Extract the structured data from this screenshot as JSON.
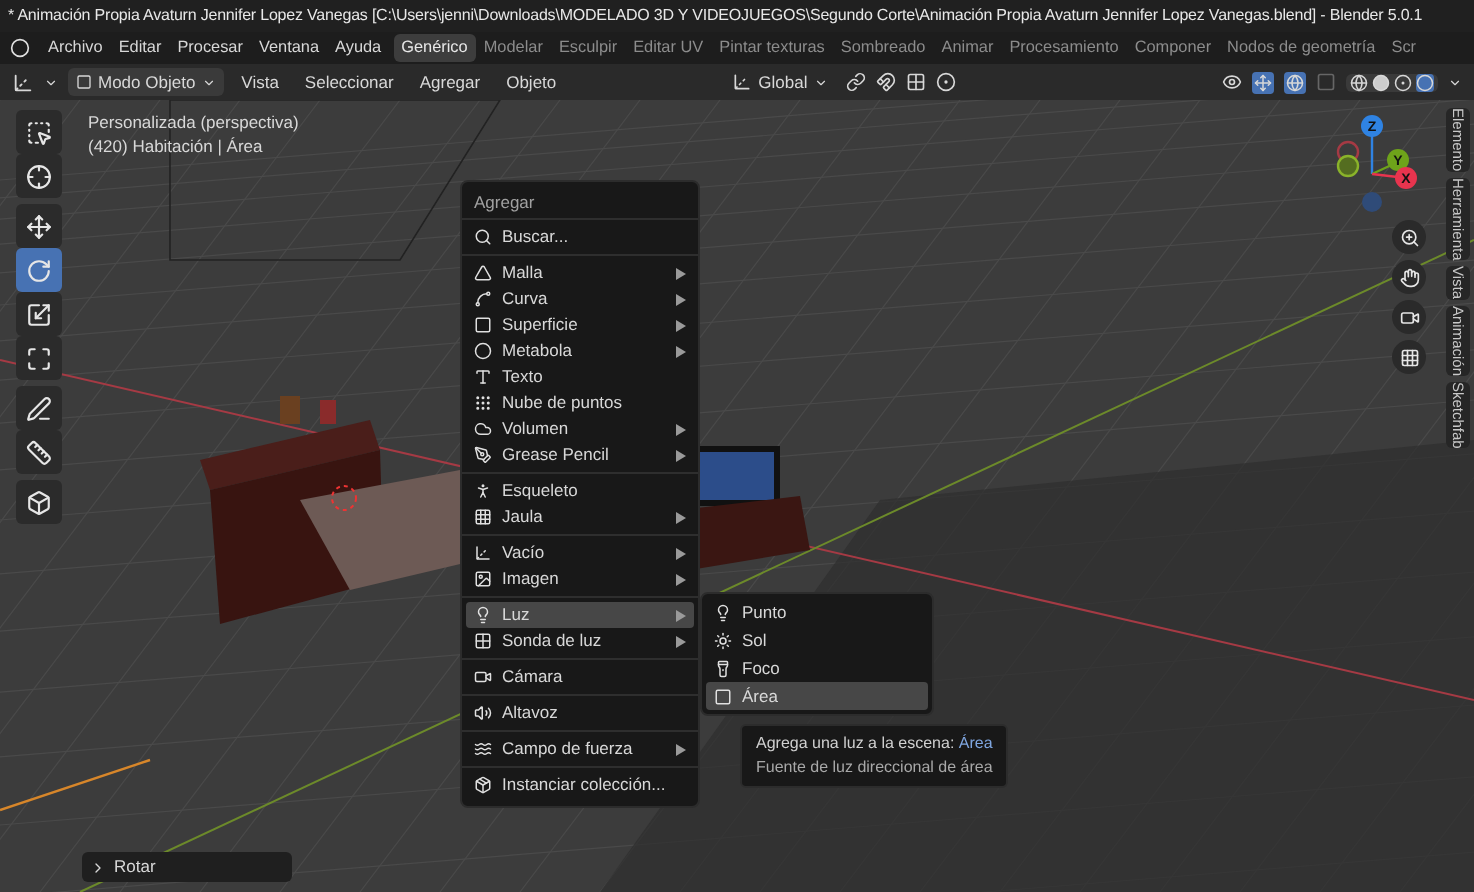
{
  "window": {
    "title": "* Animación Propia Avaturn Jennifer Lopez Vanegas [C:\\Users\\jenni\\Downloads\\MODELADO 3D Y VIDEOJUEGOS\\Segundo Corte\\Animación Propia Avaturn Jennifer Lopez Vanegas.blend] - Blender 5.0.1"
  },
  "menu_bar": {
    "items": [
      "Archivo",
      "Editar",
      "Procesar",
      "Ventana",
      "Ayuda"
    ]
  },
  "workspaces": [
    {
      "label": "Genérico",
      "selected": true
    },
    {
      "label": "Modelar",
      "selected": false
    },
    {
      "label": "Esculpir",
      "selected": false
    },
    {
      "label": "Editar UV",
      "selected": false
    },
    {
      "label": "Pintar texturas",
      "selected": false
    },
    {
      "label": "Sombreado",
      "selected": false
    },
    {
      "label": "Animar",
      "selected": false
    },
    {
      "label": "Procesamiento",
      "selected": false
    },
    {
      "label": "Componer",
      "selected": false
    },
    {
      "label": "Nodos de geometría",
      "selected": false
    },
    {
      "label": "Scr",
      "selected": false
    }
  ],
  "header": {
    "mode": "Modo Objeto",
    "menus": [
      "Vista",
      "Seleccionar",
      "Agregar",
      "Objeto"
    ],
    "orientation": "Global"
  },
  "viewport": {
    "view_name": "Personalizada (perspectiva)",
    "object_info": "(420) Habitación | Área"
  },
  "tools": [
    {
      "selected": false
    },
    {
      "selected": false
    },
    {
      "selected": false
    },
    {
      "selected": true
    },
    {
      "selected": false
    },
    {
      "selected": false
    },
    {
      "selected": false
    },
    {
      "selected": false
    },
    {
      "selected": false
    }
  ],
  "gizmo": {
    "axes": [
      "Z",
      "Y",
      "X"
    ]
  },
  "sidebar_tabs": [
    "Elemento",
    "Herramienta",
    "Vista",
    "Animación",
    "Sketchfab"
  ],
  "add_menu": {
    "title": "Agregar",
    "groups": [
      {
        "items": [
          {
            "label": "Buscar...",
            "submenu": false,
            "selected": false
          }
        ]
      },
      {
        "items": [
          {
            "label": "Malla",
            "submenu": true,
            "selected": false
          },
          {
            "label": "Curva",
            "submenu": true,
            "selected": false
          },
          {
            "label": "Superficie",
            "submenu": true,
            "selected": false
          },
          {
            "label": "Metabola",
            "submenu": true,
            "selected": false
          },
          {
            "label": "Texto",
            "submenu": false,
            "selected": false
          },
          {
            "label": "Nube de puntos",
            "submenu": false,
            "selected": false
          },
          {
            "label": "Volumen",
            "submenu": true,
            "selected": false
          },
          {
            "label": "Grease Pencil",
            "submenu": true,
            "selected": false
          }
        ]
      },
      {
        "items": [
          {
            "label": "Esqueleto",
            "submenu": false,
            "selected": false
          },
          {
            "label": "Jaula",
            "submenu": true,
            "selected": false
          }
        ]
      },
      {
        "items": [
          {
            "label": "Vacío",
            "submenu": true,
            "selected": false
          },
          {
            "label": "Imagen",
            "submenu": true,
            "selected": false
          }
        ]
      },
      {
        "items": [
          {
            "label": "Luz",
            "submenu": true,
            "selected": true
          },
          {
            "label": "Sonda de luz",
            "submenu": true,
            "selected": false
          }
        ]
      },
      {
        "items": [
          {
            "label": "Cámara",
            "submenu": false,
            "selected": false
          }
        ]
      },
      {
        "items": [
          {
            "label": "Altavoz",
            "submenu": false,
            "selected": false
          }
        ]
      },
      {
        "items": [
          {
            "label": "Campo de fuerza",
            "submenu": true,
            "selected": false
          }
        ]
      },
      {
        "items": [
          {
            "label": "Instanciar colección...",
            "submenu": false,
            "selected": false
          }
        ]
      }
    ]
  },
  "light_submenu": {
    "items": [
      {
        "label": "Punto",
        "selected": false
      },
      {
        "label": "Sol",
        "selected": false
      },
      {
        "label": "Foco",
        "selected": false
      },
      {
        "label": "Área",
        "selected": true
      }
    ]
  },
  "tooltip": {
    "text": "Agrega una luz a la escena:",
    "value": "Área",
    "description": "Fuente de luz direccional de área"
  },
  "last_operator": {
    "label": "Rotar"
  }
}
